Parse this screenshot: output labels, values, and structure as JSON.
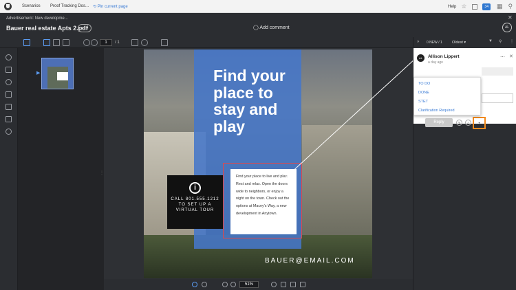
{
  "topbar": {
    "scenarios": "Scenarios",
    "project": "Proof Tracking Dos...",
    "pin": "Pin current page",
    "help": "Help",
    "badge": "34"
  },
  "header": {
    "advertisement": "Advertisement: New developme...",
    "filename": "Bauer real estate Apts 2.pdf",
    "version": "v.1",
    "add_comment": "Add comment",
    "avatar": "AL"
  },
  "toolbar": {
    "page_current": "1",
    "page_total": "/ 1"
  },
  "document": {
    "headline": "Find your place to stay and play",
    "cta": "CALL 801.555.1212 TO SET UP A VIRTUAL TOUR",
    "body": "Find your place to live and play. Rest and relax. Open the doors wide to neighbors, or enjoy a night on the town. Check out the options at Macey's Way, a new development in Anytown.",
    "email": "BAUER@EMAIL.COM",
    "info_glyph": "i"
  },
  "bottombar": {
    "zoom": "51%"
  },
  "rightpanel": {
    "new_count": "0 NEW / 1",
    "sort": "Oldest",
    "comment": {
      "author": "Allison Lippert",
      "time": "a day ago",
      "avatar": "AL"
    },
    "status_options": [
      "TO DO",
      "DONE",
      "STET",
      "Clarification Required"
    ],
    "reply_label": "Reply"
  },
  "colors": {
    "accent": "#3a7bd5",
    "highlight": "#f28a1e",
    "markup": "#e0484a",
    "doc_panel": "#4676c8"
  }
}
